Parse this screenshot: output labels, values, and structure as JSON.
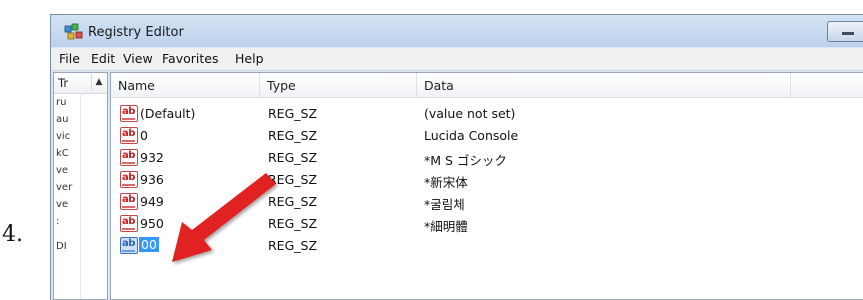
{
  "step_number": "4.",
  "window": {
    "title": "Registry Editor"
  },
  "menu": [
    "File",
    "Edit",
    "View",
    "Favorites",
    "Help"
  ],
  "tree": {
    "header": "Tr",
    "lines": [
      "ru",
      "au",
      "vic",
      "kC",
      "ve",
      "ver",
      "ve",
      ":",
      "DI"
    ]
  },
  "columns": [
    "Name",
    "Type",
    "Data"
  ],
  "rows": [
    {
      "name": "(Default)",
      "type": "REG_SZ",
      "data": "(value not set)"
    },
    {
      "name": "0",
      "type": "REG_SZ",
      "data": "Lucida Console"
    },
    {
      "name": "932",
      "type": "REG_SZ",
      "data": "*M S ゴシック"
    },
    {
      "name": "936",
      "type": "REG_SZ",
      "data": "*新宋体"
    },
    {
      "name": "949",
      "type": "REG_SZ",
      "data": "*굴림체"
    },
    {
      "name": "950",
      "type": "REG_SZ",
      "data": "*細明體"
    },
    {
      "name": "00",
      "type": "REG_SZ",
      "data": ""
    }
  ],
  "selected_row_index": 6,
  "icons": {
    "app": "registry-editor-icon",
    "value": "string-value-icon",
    "annotation": "red-arrow-icon"
  },
  "colors": {
    "arrow": "#e02020",
    "selection": "#3399ff"
  }
}
